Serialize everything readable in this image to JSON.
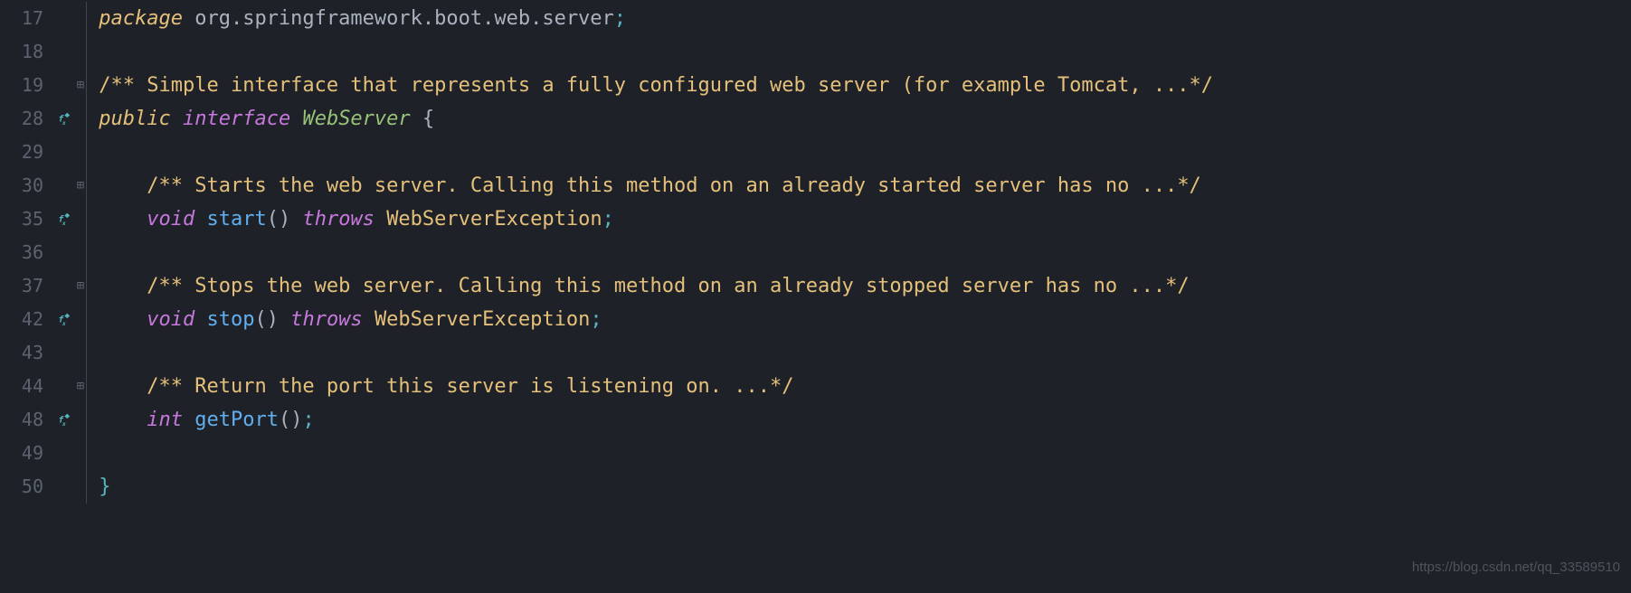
{
  "gutter": {
    "lines": [
      "17",
      "18",
      "19",
      "28",
      "29",
      "30",
      "35",
      "36",
      "37",
      "42",
      "43",
      "44",
      "48",
      "49",
      "50"
    ],
    "fx_rows": [
      3,
      6,
      9,
      12
    ]
  },
  "fold_rows": [
    2,
    5,
    8,
    11
  ],
  "code": {
    "package_kw": "package",
    "package_name": " org.springframework.boot.web.server",
    "semi": ";",
    "doc_class": "/** Simple interface that represents a fully configured web server (for example Tomcat, ...*/",
    "public_kw": "public",
    "interface_kw": "interface",
    "class_name": "WebServer",
    "open_brace": "{",
    "doc_start": "/** Starts the web server. Calling this method on an already started server has no ...*/",
    "void_kw": "void",
    "start_method": "start",
    "paren_pair": "()",
    "throws_kw": "throws",
    "exception": "WebServerException",
    "doc_stop": "/** Stops the web server. Calling this method on an already stopped server has no ...*/",
    "stop_method": "stop",
    "doc_port": "/** Return the port this server is listening on. ...*/",
    "int_kw": "int",
    "getport_method": "getPort",
    "close_brace": "}"
  },
  "watermark": "https://blog.csdn.net/qq_33589510",
  "indent1": "    ",
  "indent2": "        "
}
